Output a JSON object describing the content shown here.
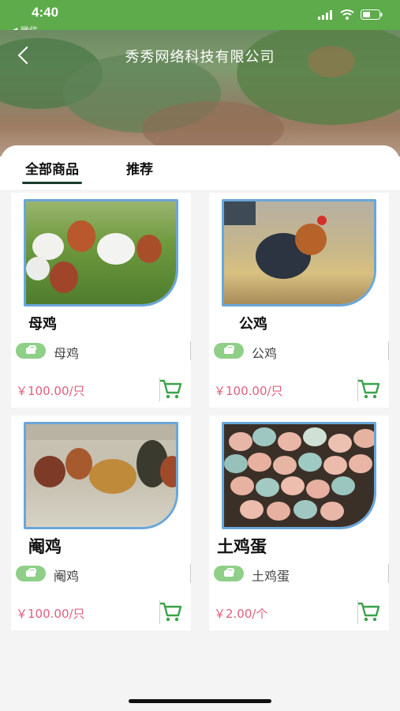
{
  "status_bar": {
    "time": "4:40",
    "back_app": "◀ 微信"
  },
  "header": {
    "title": "秀秀网络科技有限公司"
  },
  "tabs": [
    {
      "label": "全部商品",
      "active": true
    },
    {
      "label": "推荐",
      "active": false
    }
  ],
  "products": [
    {
      "name": "母鸡",
      "sub_label": "母鸡",
      "price": "￥100.00/只"
    },
    {
      "name": "公鸡",
      "sub_label": "公鸡",
      "price": "￥100.00/只"
    },
    {
      "name": "阉鸡",
      "sub_label": "阉鸡",
      "price": "￥100.00/只"
    },
    {
      "name": "土鸡蛋",
      "sub_label": "土鸡蛋",
      "price": "￥2.00/个"
    }
  ],
  "colors": {
    "green": "#5dab4a",
    "price": "#e0607e",
    "photo_border": "#6aa6d9",
    "cart": "#3aa24a"
  },
  "icons": [
    "back-icon",
    "cellular-icon",
    "wifi-icon",
    "battery-icon",
    "cart-icon",
    "shop-bag-icon"
  ]
}
